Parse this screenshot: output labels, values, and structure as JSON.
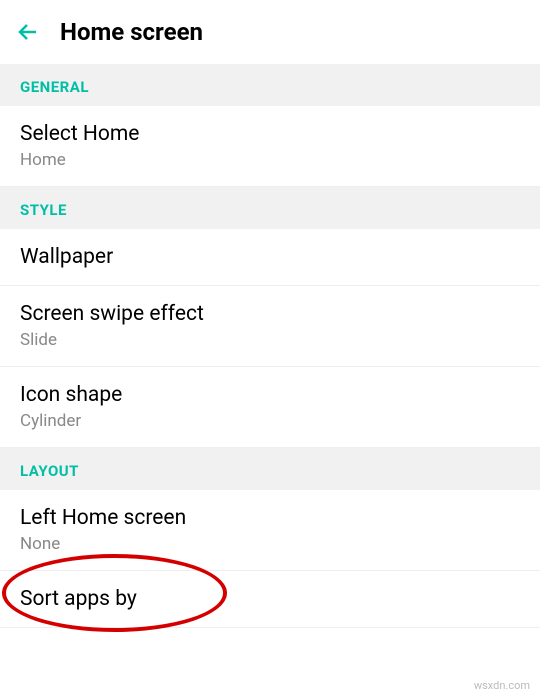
{
  "header": {
    "title": "Home screen"
  },
  "sections": {
    "general": {
      "label": "GENERAL",
      "select_home": {
        "title": "Select Home",
        "value": "Home"
      }
    },
    "style": {
      "label": "STYLE",
      "wallpaper": {
        "title": "Wallpaper"
      },
      "swipe_effect": {
        "title": "Screen swipe effect",
        "value": "Slide"
      },
      "icon_shape": {
        "title": "Icon shape",
        "value": "Cylinder"
      }
    },
    "layout": {
      "label": "LAYOUT",
      "left_home": {
        "title": "Left Home screen",
        "value": "None"
      },
      "sort_apps": {
        "title": "Sort apps by"
      }
    }
  },
  "watermark": "wsxdn.com"
}
